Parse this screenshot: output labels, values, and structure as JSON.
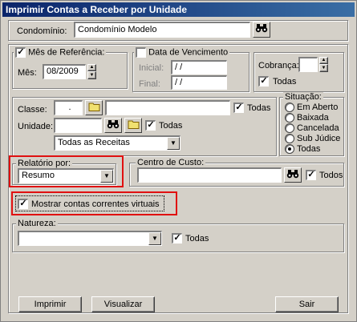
{
  "window": {
    "title": "Imprimir Contas a Receber por Unidade"
  },
  "condominio": {
    "label": "Condomínio:",
    "value": "Condomínio Modelo"
  },
  "mes_referencia": {
    "legend": "Mês de Referência:",
    "checked": true,
    "mes_label": "Mês:",
    "mes_value": "08/2009"
  },
  "data_vencimento": {
    "legend": "Data de Vencimento",
    "checked": false,
    "inicial_label": "Inicial:",
    "inicial_value": " / /",
    "final_label": "Final:",
    "final_value": " / /"
  },
  "cobranca": {
    "label": "Cobrança:",
    "todas_label": "Todas",
    "todas_checked": true
  },
  "classe": {
    "label": "Classe:",
    "code": ".",
    "todas_label": "Todas",
    "todas_checked": true
  },
  "unidade": {
    "label": "Unidade:",
    "todas_label": "Todas",
    "todas_checked": true
  },
  "receitas_select": {
    "value": "Todas as Receitas"
  },
  "situacao": {
    "legend": "Situação:",
    "options": [
      "Em Aberto",
      "Baixada",
      "Cancelada",
      "Sub Júdice",
      "Todas"
    ],
    "selected": "Todas"
  },
  "relatorio": {
    "legend": "Relatório por:",
    "value": "Resumo"
  },
  "centro_custo": {
    "legend": "Centro de Custo:",
    "todos_label": "Todos",
    "todos_checked": true
  },
  "contas_virtuais": {
    "label": "Mostrar contas correntes virtuais",
    "checked": true
  },
  "natureza": {
    "legend": "Natureza:",
    "value": "",
    "todas_label": "Todas",
    "todas_checked": true
  },
  "buttons": {
    "imprimir": "Imprimir",
    "visualizar": "Visualizar",
    "sair": "Sair"
  },
  "icons": {
    "binoculars": "binoculars-icon",
    "folder": "folder-icon"
  },
  "colors": {
    "title_bar": "#0a246a",
    "highlight": "#e01010",
    "face": "#d4d0c8"
  }
}
